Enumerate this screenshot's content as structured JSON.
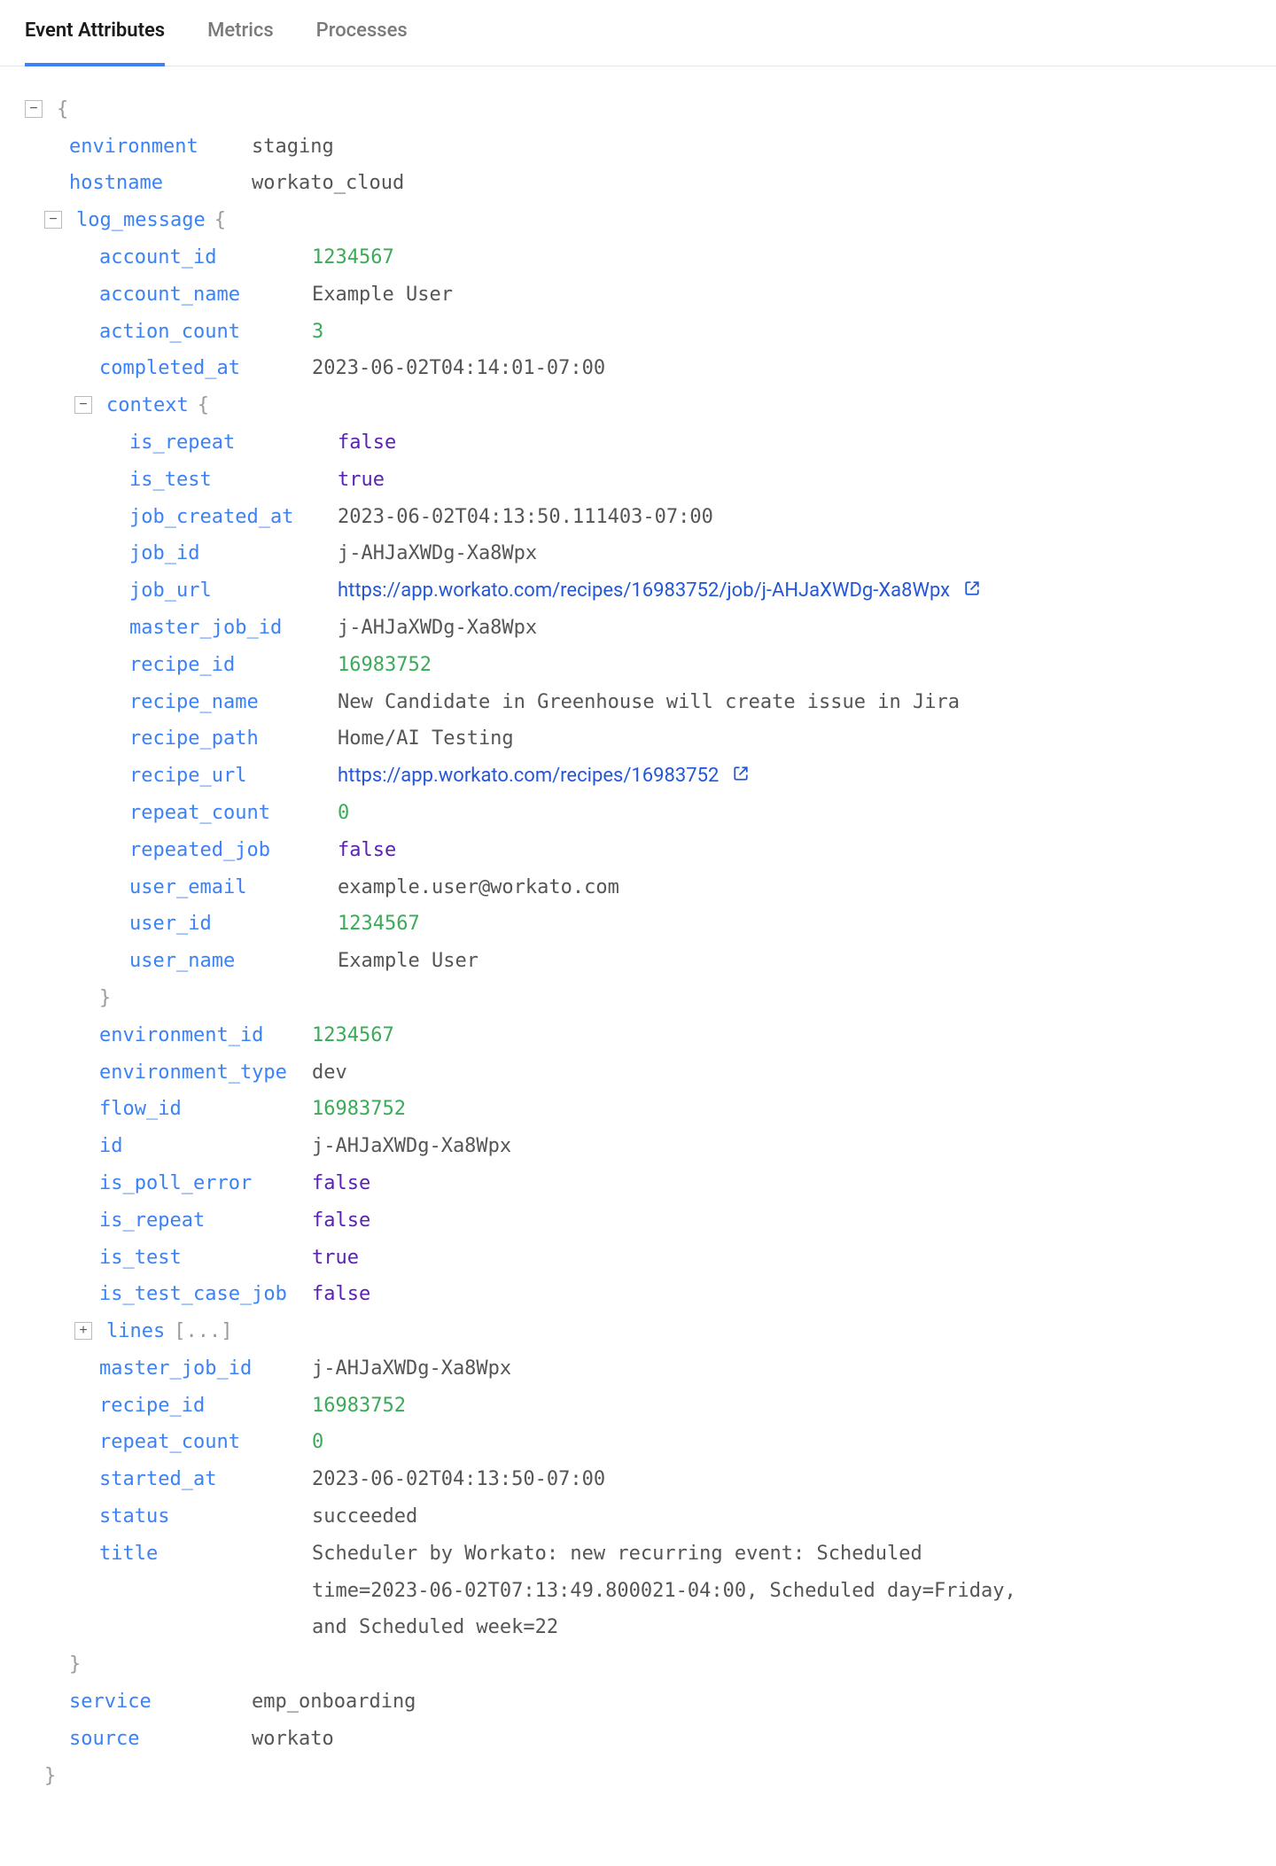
{
  "tabs": [
    {
      "id": "event-attributes",
      "label": "Event Attributes",
      "active": true
    },
    {
      "id": "metrics",
      "label": "Metrics",
      "active": false
    },
    {
      "id": "processes",
      "label": "Processes",
      "active": false
    }
  ],
  "root": {
    "environment": "staging",
    "hostname": "workato_cloud",
    "log_message": {
      "account_id": 1234567,
      "account_name": "Example User",
      "action_count": 3,
      "completed_at": "2023-06-02T04:14:01-07:00",
      "context": {
        "is_repeat": false,
        "is_test": true,
        "job_created_at": "2023-06-02T04:13:50.111403-07:00",
        "job_id": "j-AHJaXWDg-Xa8Wpx",
        "job_url": "https://app.workato.com/recipes/16983752/job/j-AHJaXWDg-Xa8Wpx",
        "master_job_id": "j-AHJaXWDg-Xa8Wpx",
        "recipe_id": 16983752,
        "recipe_name": "New Candidate in Greenhouse will create issue in Jira",
        "recipe_path": "Home/AI Testing",
        "recipe_url": "https://app.workato.com/recipes/16983752",
        "repeat_count": 0,
        "repeated_job": false,
        "user_email": "example.user@workato.com",
        "user_id": 1234567,
        "user_name": "Example User"
      },
      "environment_id": 1234567,
      "environment_type": "dev",
      "flow_id": 16983752,
      "id": "j-AHJaXWDg-Xa8Wpx",
      "is_poll_error": false,
      "is_repeat": false,
      "is_test": true,
      "is_test_case_job": false,
      "lines_collapsed": "[...]",
      "master_job_id": "j-AHJaXWDg-Xa8Wpx",
      "recipe_id": 16983752,
      "repeat_count": 0,
      "started_at": "2023-06-02T04:13:50-07:00",
      "status": "succeeded",
      "title": "Scheduler by Workato: new recurring event: Scheduled time=2023-06-02T07:13:49.800021-04:00, Scheduled day=Friday, and Scheduled week=22"
    },
    "service": "emp_onboarding",
    "source": "workato"
  },
  "labels": {
    "environment": "environment",
    "hostname": "hostname",
    "log_message": "log_message",
    "account_id": "account_id",
    "account_name": "account_name",
    "action_count": "action_count",
    "completed_at": "completed_at",
    "context": "context",
    "is_repeat": "is_repeat",
    "is_test": "is_test",
    "job_created_at": "job_created_at",
    "job_id": "job_id",
    "job_url": "job_url",
    "master_job_id": "master_job_id",
    "recipe_id": "recipe_id",
    "recipe_name": "recipe_name",
    "recipe_path": "recipe_path",
    "recipe_url": "recipe_url",
    "repeat_count": "repeat_count",
    "repeated_job": "repeated_job",
    "user_email": "user_email",
    "user_id": "user_id",
    "user_name": "user_name",
    "environment_id": "environment_id",
    "environment_type": "environment_type",
    "flow_id": "flow_id",
    "id": "id",
    "is_poll_error": "is_poll_error",
    "is_test_case_job": "is_test_case_job",
    "lines": "lines",
    "started_at": "started_at",
    "status": "status",
    "title": "title",
    "service": "service",
    "source": "source"
  }
}
